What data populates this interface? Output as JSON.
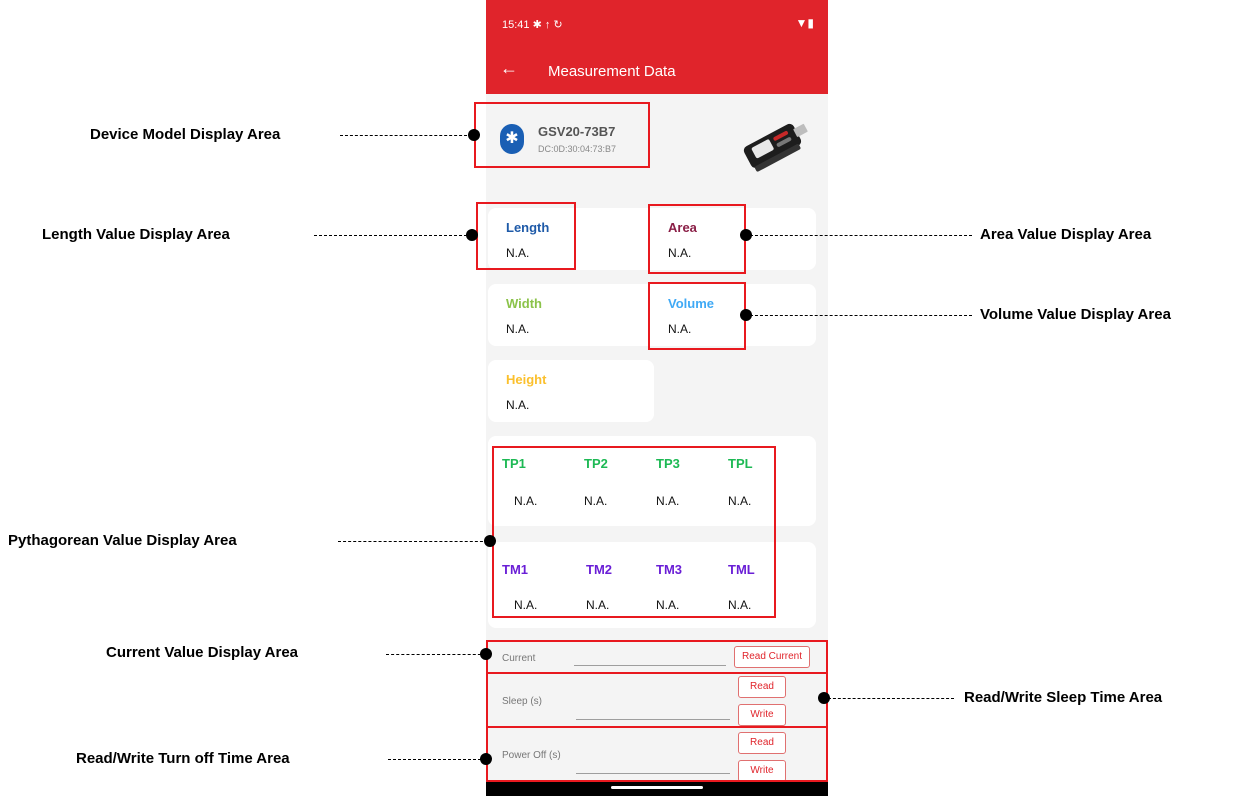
{
  "status": {
    "time": "15:41",
    "left_icons": "✱ ↑ ↻",
    "right_icons": "▼▮"
  },
  "appbar": {
    "back": "←",
    "title": "Measurement Data"
  },
  "device": {
    "name": "GSV20-73B7",
    "mac": "DC:0D:30:04:73:B7"
  },
  "measurements": {
    "length": {
      "label": "Length",
      "value": "N.A.",
      "color": "#1e5aa8"
    },
    "area": {
      "label": "Area",
      "value": "N.A.",
      "color": "#8a1e46"
    },
    "width": {
      "label": "Width",
      "value": "N.A.",
      "color": "#8bc34a"
    },
    "volume": {
      "label": "Volume",
      "value": "N.A.",
      "color": "#3fa9f5"
    },
    "height": {
      "label": "Height",
      "value": "N.A.",
      "color": "#fbc02d"
    }
  },
  "pyth_plus": {
    "labels": [
      "TP1",
      "TP2",
      "TP3",
      "TPL"
    ],
    "values": [
      "N.A.",
      "N.A.",
      "N.A.",
      "N.A."
    ],
    "color": "#1db954"
  },
  "pyth_minus": {
    "labels": [
      "TM1",
      "TM2",
      "TM3",
      "TML"
    ],
    "values": [
      "N.A.",
      "N.A.",
      "N.A.",
      "N.A."
    ],
    "color": "#6a1fd6"
  },
  "controls": {
    "current_label": "Current",
    "read_current": "Read Current",
    "sleep_label": "Sleep (s)",
    "poweroff_label": "Power Off (s)",
    "read": "Read",
    "write": "Write"
  },
  "annotations": {
    "device_model": "Device Model Display Area",
    "length": "Length Value Display Area",
    "area": "Area Value Display Area",
    "volume": "Volume Value Display Area",
    "pythagorean": "Pythagorean Value Display Area",
    "current": "Current Value Display Area",
    "sleep": "Read/Write Sleep Time Area",
    "turnoff": "Read/Write Turn off Time Area"
  }
}
